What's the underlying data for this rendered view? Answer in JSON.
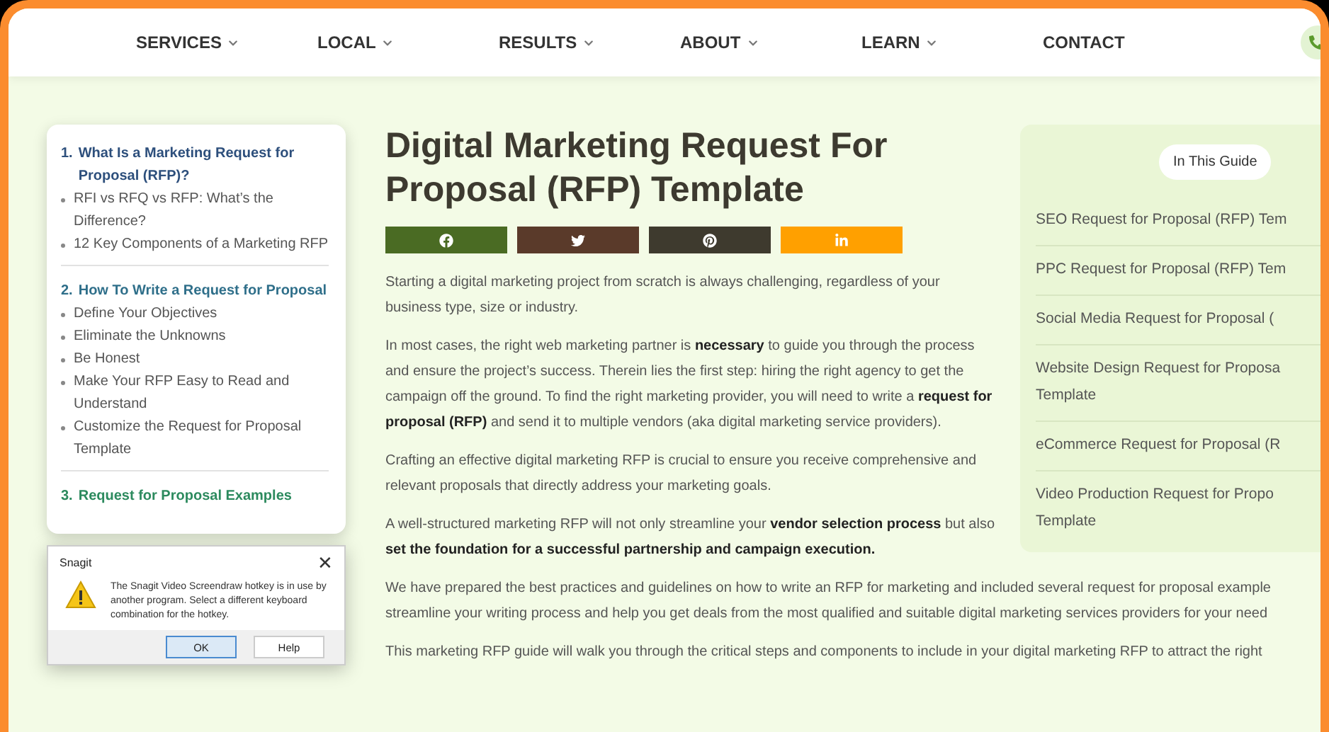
{
  "nav": {
    "items": [
      {
        "label": "SERVICES",
        "dropdown": true
      },
      {
        "label": "LOCAL",
        "dropdown": true
      },
      {
        "label": "RESULTS",
        "dropdown": true
      },
      {
        "label": "ABOUT",
        "dropdown": true
      },
      {
        "label": "LEARN",
        "dropdown": true
      },
      {
        "label": "CONTACT",
        "dropdown": false
      }
    ]
  },
  "toc": {
    "sections": [
      {
        "number": "1.",
        "title": "What Is a Marketing Request for Proposal (RFP)?",
        "color": "#2d4f7c",
        "items": [
          "RFI vs RFQ vs RFP: What’s the Difference?",
          "12 Key Components of a Marketing RFP"
        ]
      },
      {
        "number": "2.",
        "title": "How To Write a Request for Proposal",
        "color": "#2f6f8a",
        "items": [
          "Define Your Objectives",
          "Eliminate the Unknowns",
          "Be Honest",
          "Make Your RFP Easy to Read and Understand",
          "Customize the Request for Proposal Template"
        ]
      },
      {
        "number": "3.",
        "title": "Request for Proposal Examples",
        "color": "#2c8a5e"
      }
    ]
  },
  "article": {
    "title": "Digital Marketing Request For Proposal (RFP) Template",
    "share_buttons": [
      {
        "kind": "facebook",
        "color": "#4a6b23"
      },
      {
        "kind": "twitter",
        "color": "#5a3a2a"
      },
      {
        "kind": "pinterest",
        "color": "#3e3a2e"
      },
      {
        "kind": "linkedin",
        "color": "#ffa000"
      }
    ],
    "intro_paragraphs": [
      "Starting a digital marketing project from scratch is always challenging, regardless of your business type, size or industry.",
      "In most cases, the right web marketing partner is **necessary** to guide you through the process and ensure the project’s success. Therein lies the first step: hiring the right agency to get the campaign off the ground. To find the right marketing provider, you will need to write a **request for proposal (RFP)** and send it to multiple vendors (aka digital marketing service providers).",
      "Crafting an effective digital marketing RFP is crucial to ensure you receive comprehensive and relevant proposals that directly address your marketing goals.",
      "A well-structured marketing RFP will not only streamline your **vendor selection process** but also **set the foundation for a successful partnership and campaign execution.**"
    ],
    "paragraphs": [
      "We have prepared the best practices and guidelines on how to write an RFP for marketing and included several request for proposal example streamline your writing process and help you get deals from the most qualified and suitable digital marketing services providers for your need",
      "This marketing RFP guide will walk you through the critical steps and components to include in your digital marketing RFP to attract the right"
    ]
  },
  "guide": {
    "heading": "In This Guide",
    "items": [
      "SEO Request for Proposal (RFP) Tem",
      "PPC Request for Proposal (RFP) Tem",
      "Social Media Request for Proposal (",
      "Website Design Request for Proposa Template",
      "eCommerce Request for Proposal (R",
      "Video Production Request for Propo Template"
    ]
  },
  "dialog": {
    "title": "Snagit",
    "close": "✕",
    "message": "The Snagit Video Screendraw hotkey is in use by another program. Select a different keyboard combination for the hotkey.",
    "buttons": [
      {
        "label": "OK",
        "selected": true
      },
      {
        "label": "Help",
        "selected": false
      }
    ]
  }
}
